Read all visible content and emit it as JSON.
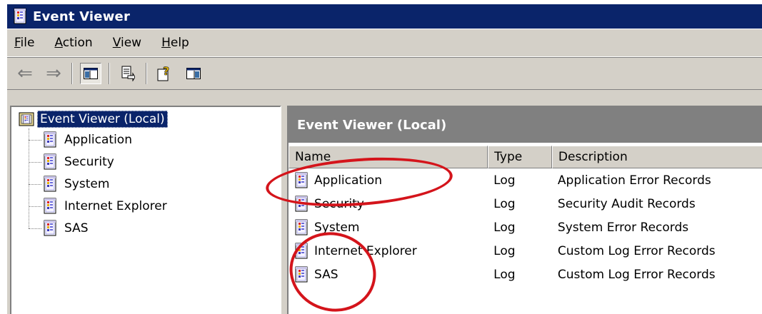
{
  "window": {
    "title": "Event Viewer"
  },
  "menu": [
    {
      "underline": "F",
      "rest": "ile"
    },
    {
      "underline": "A",
      "rest": "ction"
    },
    {
      "underline": "V",
      "rest": "iew"
    },
    {
      "underline": "H",
      "rest": "elp"
    }
  ],
  "toolbar": {
    "icons": [
      "back-arrow-icon",
      "forward-arrow-icon",
      "show-hide-tree-icon",
      "export-list-icon",
      "help-icon",
      "show-hide-action-pane-icon"
    ],
    "back_glyph": "⇐",
    "forward_glyph": "⇒"
  },
  "tree": {
    "root": "Event Viewer (Local)",
    "items": [
      "Application",
      "Security",
      "System",
      "Internet Explorer",
      "SAS"
    ]
  },
  "list": {
    "header_title": "Event Viewer (Local)",
    "columns": [
      "Name",
      "Type",
      "Description"
    ],
    "rows": [
      {
        "name": "Application",
        "type": "Log",
        "description": "Application Error Records"
      },
      {
        "name": "Security",
        "type": "Log",
        "description": "Security Audit Records"
      },
      {
        "name": "System",
        "type": "Log",
        "description": "System Error Records"
      },
      {
        "name": "Internet Explorer",
        "type": "Log",
        "description": "Custom Log Error Records"
      },
      {
        "name": "SAS",
        "type": "Log",
        "description": "Custom Log Error Records"
      }
    ]
  },
  "colors": {
    "titlebar": "#0a246a",
    "header": "#808080",
    "annotation": "#d4141b"
  }
}
